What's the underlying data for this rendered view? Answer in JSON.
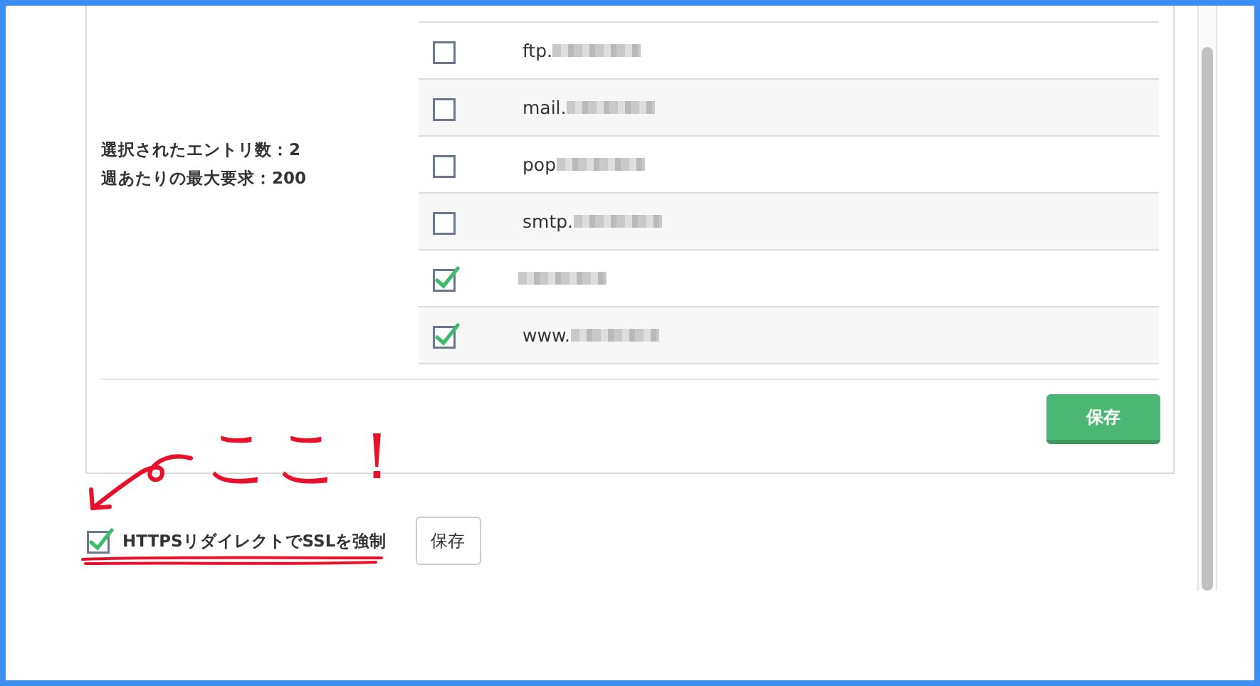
{
  "panel": {
    "summary": [
      "選択されたエントリ数：2",
      "週あたりの最大要求：200"
    ],
    "entries": [
      {
        "text": "ftp.",
        "checked": false,
        "blurred": true
      },
      {
        "text": "mail.",
        "checked": false,
        "blurred": true
      },
      {
        "text": "pop",
        "checked": false,
        "blurred": true
      },
      {
        "text": "smtp.",
        "checked": false,
        "blurred": true
      },
      {
        "checked": true,
        "blurred": true
      },
      {
        "text": "www.",
        "checked": true,
        "blurred": true
      }
    ],
    "save_button": "保存"
  },
  "https_redirect": {
    "label": "HTTPSリダイレクトでSSLを強制",
    "checked": true,
    "button": "保存"
  },
  "annotation": {
    "text": "ここ！"
  }
}
